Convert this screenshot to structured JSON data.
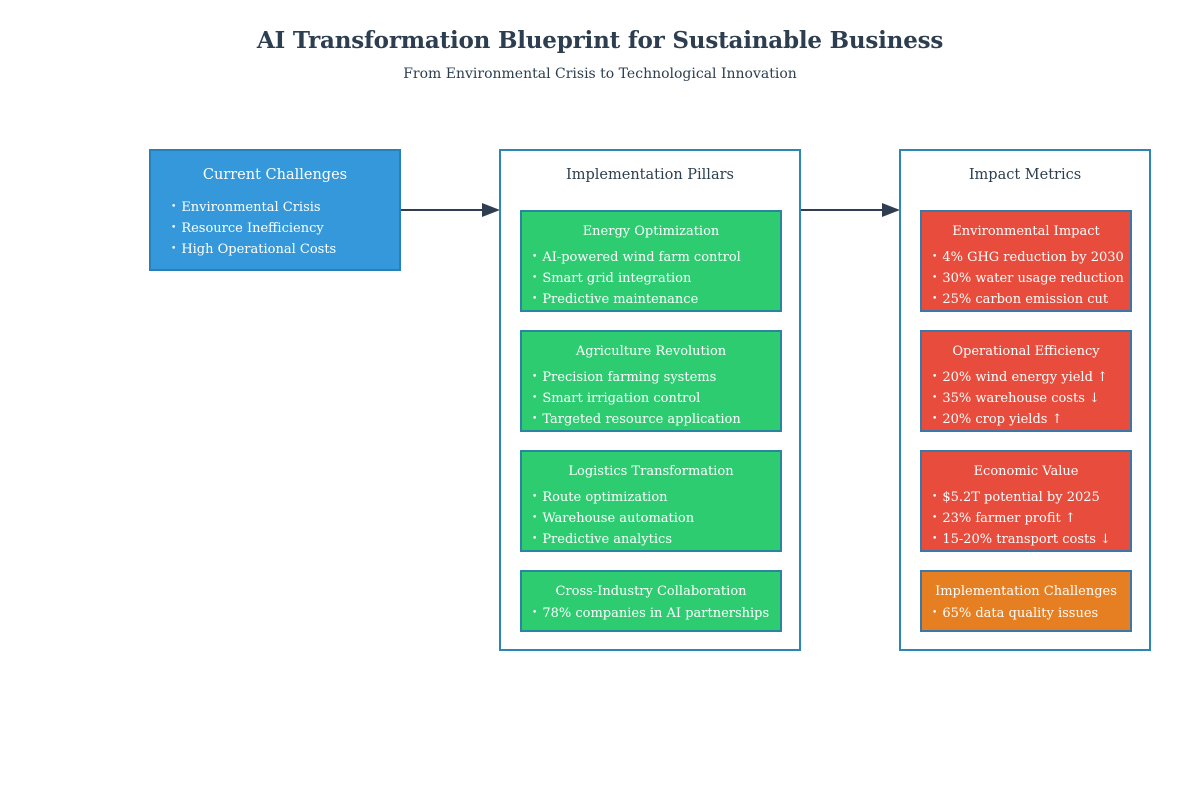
{
  "header": {
    "title": "AI Transformation Blueprint for Sustainable Business",
    "subtitle": "From Environmental Crisis to Technological Innovation"
  },
  "colors": {
    "challenges_bg": "#3498db",
    "pillar_bg": "#2ecc71",
    "metric_bg": "#e74c3c",
    "warning_bg": "#e67e22",
    "border": "#2980b9",
    "text_dark": "#2c3e50",
    "arrow": "#2c3e50"
  },
  "challenges": {
    "title": "Current Challenges",
    "items": [
      "Environmental Crisis",
      "Resource Inefficiency",
      "High Operational Costs"
    ]
  },
  "pillars": {
    "title": "Implementation Pillars",
    "cards": [
      {
        "title": "Energy Optimization",
        "items": [
          "AI-powered wind farm control",
          "Smart grid integration",
          "Predictive maintenance"
        ]
      },
      {
        "title": "Agriculture Revolution",
        "items": [
          "Precision farming systems",
          "Smart irrigation control",
          "Targeted resource application"
        ]
      },
      {
        "title": "Logistics Transformation",
        "items": [
          "Route optimization",
          "Warehouse automation",
          "Predictive analytics"
        ]
      },
      {
        "title": "Cross-Industry Collaboration",
        "items": [
          "78% companies in AI partnerships"
        ]
      }
    ]
  },
  "metrics": {
    "title": "Impact Metrics",
    "cards": [
      {
        "title": "Environmental Impact",
        "items": [
          "4% GHG reduction by 2030",
          "30% water usage reduction",
          "25% carbon emission cut"
        ]
      },
      {
        "title": "Operational Efficiency",
        "items": [
          "20% wind energy yield ↑",
          "35% warehouse costs ↓",
          "20% crop yields ↑"
        ]
      },
      {
        "title": "Economic Value",
        "items": [
          "$5.2T potential by 2025",
          "23% farmer profit ↑",
          "15-20% transport costs ↓"
        ]
      },
      {
        "title": "Implementation Challenges",
        "items": [
          "65% data quality issues"
        ]
      }
    ]
  }
}
